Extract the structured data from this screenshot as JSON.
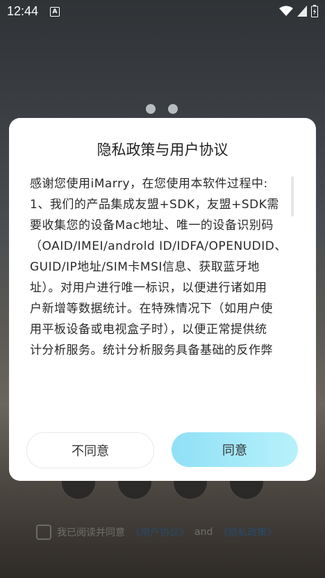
{
  "status_bar": {
    "time": "12:44",
    "keyboard_indicator": "A"
  },
  "dialog": {
    "title": "隐私政策与用户协议",
    "lines": [
      "感谢您使用iMarry，在您使用本软件过程中:",
      "1、我们的产品集成友盟+SDK，友盟+SDK需",
      "要收集您的设备Mac地址、唯一的设备识别码",
      "（OAID/IMEI/androld ID/IDFA/OPENUDID、",
      "GUID/IP地址/SIM卡MSI信息、获取蓝牙地",
      "址）。对用户进行唯一标识，以便进行诸如用",
      "户新增等数据统计。在特殊情况下（如用户使",
      "用平板设备或电视盒子时），以便正常提供统",
      "计分析服务。统计分析服务具备基础的反作弊"
    ],
    "decline_label": "不同意",
    "agree_label": "同意"
  },
  "agreement_row": {
    "prefix": "我已阅读并同意",
    "user_agreement": "《用户协议》",
    "and": "and",
    "privacy_policy": "《隐私政策》"
  },
  "colors": {
    "agree_start": "#8fe0f6",
    "agree_end": "#b7f1fb",
    "link": "#2b4a6a"
  }
}
